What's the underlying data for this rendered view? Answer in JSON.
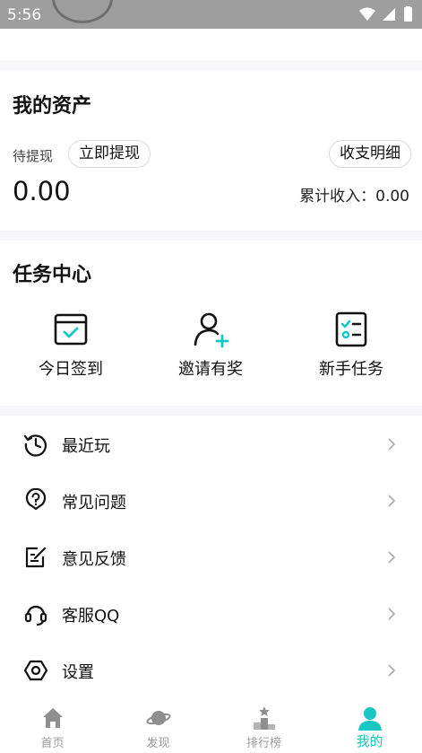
{
  "status_bar": {
    "time": "5:56",
    "icons": [
      "wifi-icon",
      "signal-icon",
      "battery-icon"
    ]
  },
  "assets": {
    "title": "我的资产",
    "pending_label": "待提现",
    "withdraw_label": "立即提现",
    "detail_label": "收支明细",
    "balance": "0.00",
    "total_income": "累计收入：0.00"
  },
  "tasks": {
    "title": "任务中心",
    "items": [
      {
        "label": "今日签到",
        "icon": "calendar-check-icon"
      },
      {
        "label": "邀请有奖",
        "icon": "add-user-icon"
      },
      {
        "label": "新手任务",
        "icon": "checklist-icon"
      }
    ]
  },
  "menu": {
    "items": [
      {
        "label": "最近玩",
        "icon": "history-icon"
      },
      {
        "label": "常见问题",
        "icon": "question-icon"
      },
      {
        "label": "意见反馈",
        "icon": "feedback-edit-icon"
      },
      {
        "label": "客服QQ",
        "icon": "headset-icon"
      },
      {
        "label": "设置",
        "icon": "settings-hexagon-icon"
      }
    ]
  },
  "tabbar": {
    "items": [
      {
        "label": "首页",
        "icon": "home-icon"
      },
      {
        "label": "发现",
        "icon": "planet-icon"
      },
      {
        "label": "排行榜",
        "icon": "podium-icon"
      },
      {
        "label": "我的",
        "icon": "person-icon",
        "active": true
      }
    ]
  },
  "colors": {
    "accent": "#17c7c4",
    "status_bar": "#9e9e9e",
    "inactive": "#9a9a9a"
  }
}
